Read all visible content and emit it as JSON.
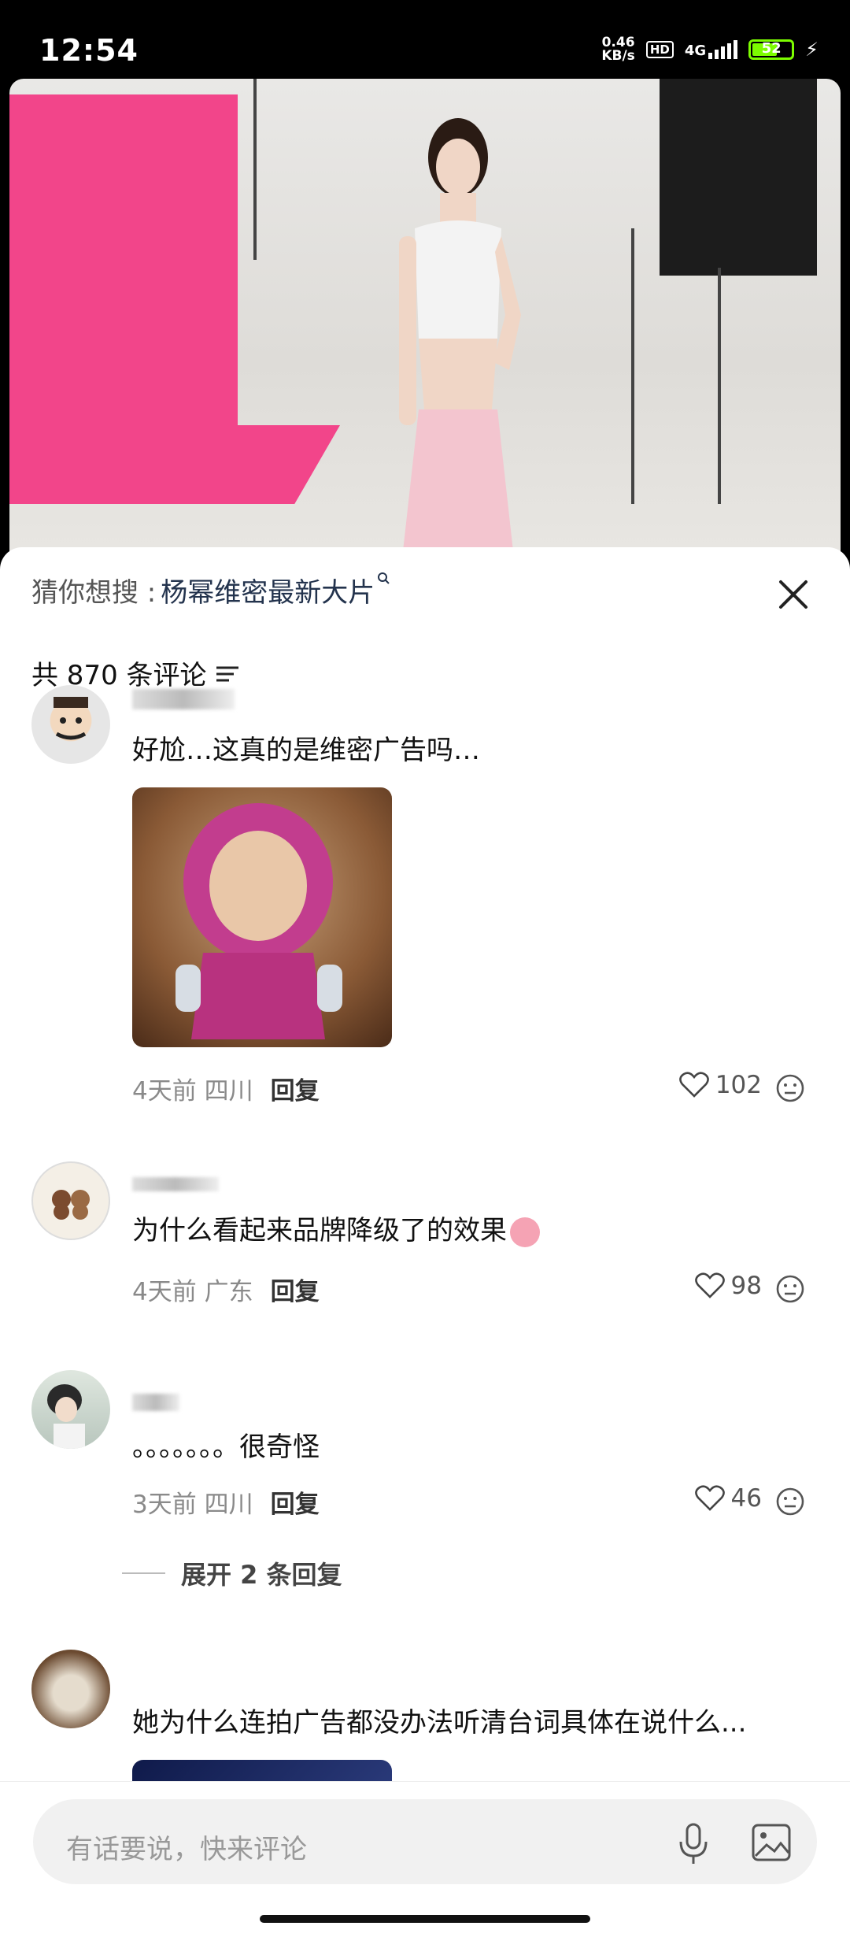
{
  "status_bar": {
    "time": "12:54",
    "netspeed_value": "0.46",
    "netspeed_unit": "KB/s",
    "hd": "HD",
    "network": "4G",
    "battery": "52"
  },
  "search_suggestion": {
    "prefix": "猜你想搜 :",
    "term": "杨幂维密最新大片"
  },
  "comments_header": {
    "count_label": "共 870 条评论"
  },
  "comments": [
    {
      "text": "好尬…这真的是维密广告吗…",
      "time": "4天前",
      "location": "四川",
      "reply_label": "回复",
      "likes": "102"
    },
    {
      "text": "为什么看起来品牌降级了的效果",
      "time": "4天前",
      "location": "广东",
      "reply_label": "回复",
      "likes": "98"
    },
    {
      "text": "。。。。。。。很奇怪",
      "time": "3天前",
      "location": "四川",
      "reply_label": "回复",
      "likes": "46",
      "expand_label": "展开 2 条回复"
    },
    {
      "text": "她为什么连拍广告都没办法听清台词具体在说什么..."
    }
  ],
  "input_bar": {
    "placeholder": "有话要说，快来评论"
  },
  "colors": {
    "pink_backdrop": "#f2458a",
    "battery_green": "#7CFC00",
    "suggest_term": "#23334d"
  }
}
